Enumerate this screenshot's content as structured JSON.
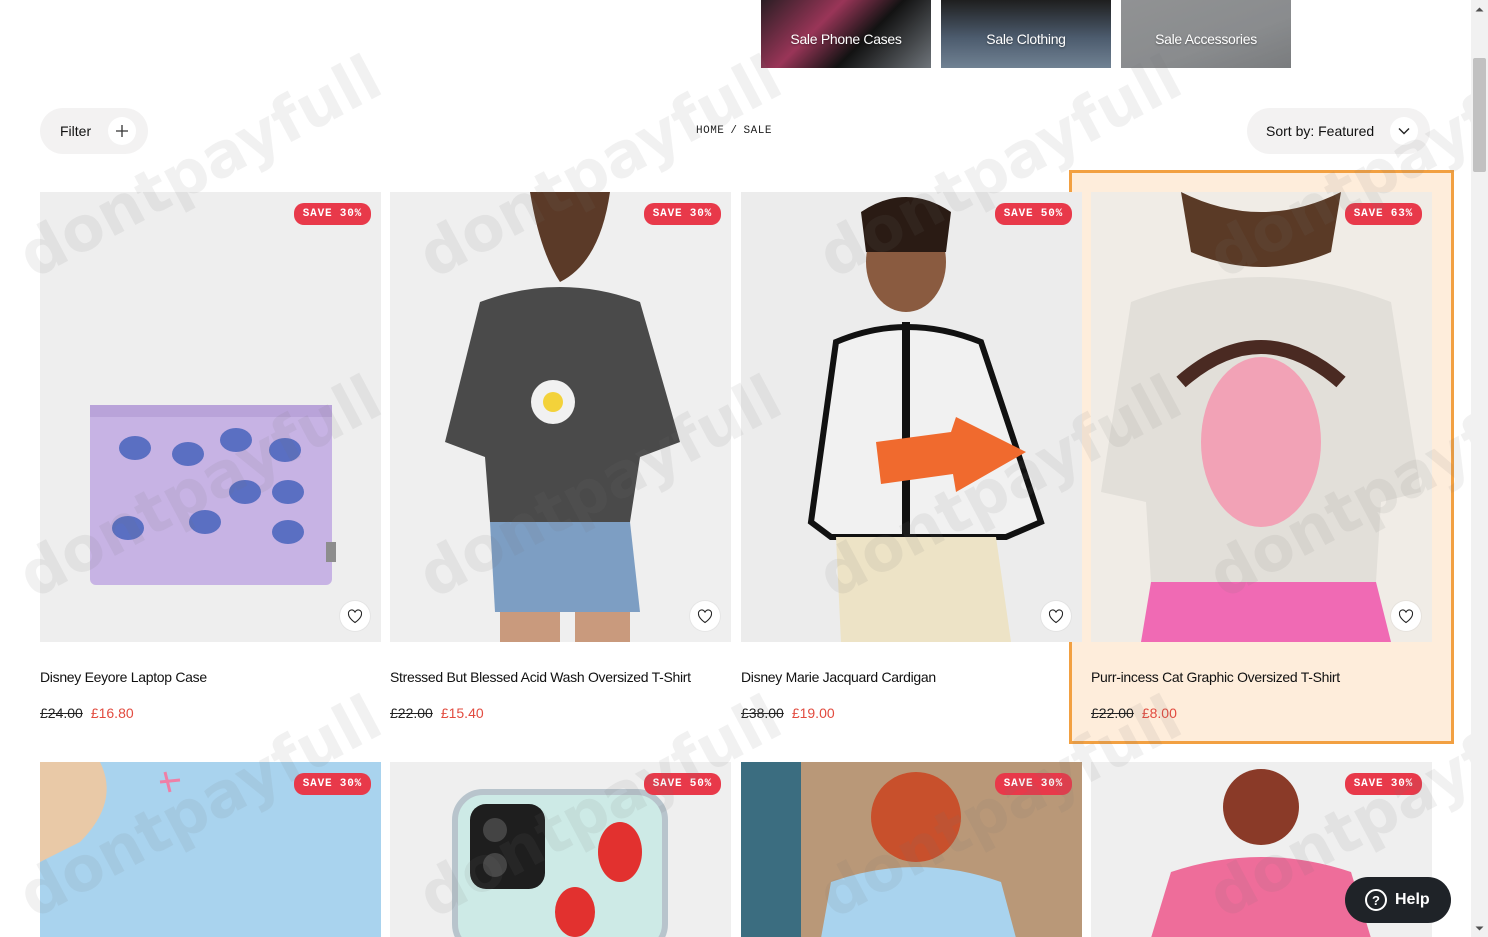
{
  "categories": [
    {
      "label": "Sale Phone Cases"
    },
    {
      "label": "Sale Clothing"
    },
    {
      "label": "Sale Accessories"
    }
  ],
  "toolbar": {
    "filter_label": "Filter",
    "sort_label": "Sort by: Featured"
  },
  "breadcrumb": {
    "home": "HOME",
    "separator": "/",
    "current": "SALE"
  },
  "products": [
    {
      "name": "Disney Eeyore Laptop Case",
      "was": "£24.00",
      "now": "£16.80",
      "badge": "SAVE 30%"
    },
    {
      "name": "Stressed But Blessed Acid Wash Oversized T-Shirt",
      "was": "£22.00",
      "now": "£15.40",
      "badge": "SAVE 30%"
    },
    {
      "name": "Disney Marie Jacquard Cardigan",
      "was": "£38.00",
      "now": "£19.00",
      "badge": "SAVE 50%"
    },
    {
      "name": "Purr-incess Cat Graphic Oversized T-Shirt",
      "was": "£22.00",
      "now": "£8.00",
      "badge": "SAVE 63%"
    }
  ],
  "products_row2": [
    {
      "badge": "SAVE 30%"
    },
    {
      "badge": "SAVE 50%"
    },
    {
      "badge": "SAVE 30%"
    },
    {
      "badge": "SAVE 30%"
    }
  ],
  "help": {
    "label": "Help",
    "glyph": "?"
  },
  "watermark": {
    "text": "dontpayfull"
  },
  "colors": {
    "sale_price": "#e24b3f",
    "badge": "#e8394a",
    "highlight_border": "#f2a041"
  }
}
